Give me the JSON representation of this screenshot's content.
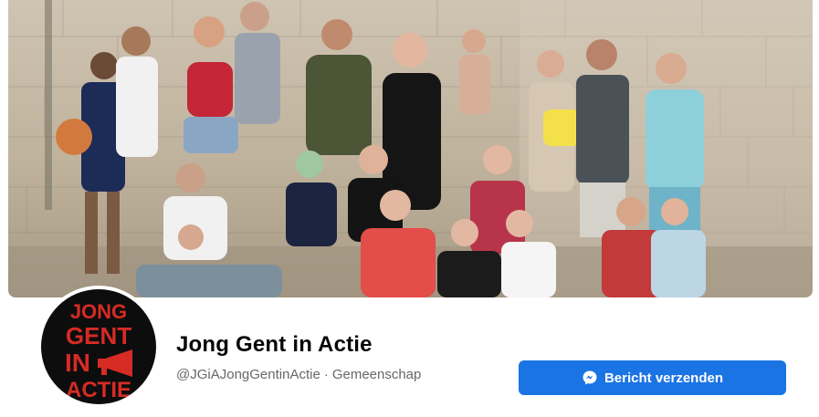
{
  "page": {
    "name": "Jong Gent in Actie",
    "handle": "@JGiAJongGentinActie",
    "separator": "·",
    "category": "Gemeenschap"
  },
  "actions": {
    "message_label": "Bericht verzenden",
    "message_icon": "messenger-icon"
  },
  "avatar": {
    "logo_lines": [
      "JONG",
      "GENT",
      "IN",
      "ACTIE"
    ],
    "logo_icon": "megaphone-icon",
    "colors": {
      "background": "#0d0d0d",
      "text": "#d62b25"
    }
  },
  "colors": {
    "accent": "#1b74e4",
    "name_text": "#050505",
    "secondary_text": "#65676b"
  }
}
